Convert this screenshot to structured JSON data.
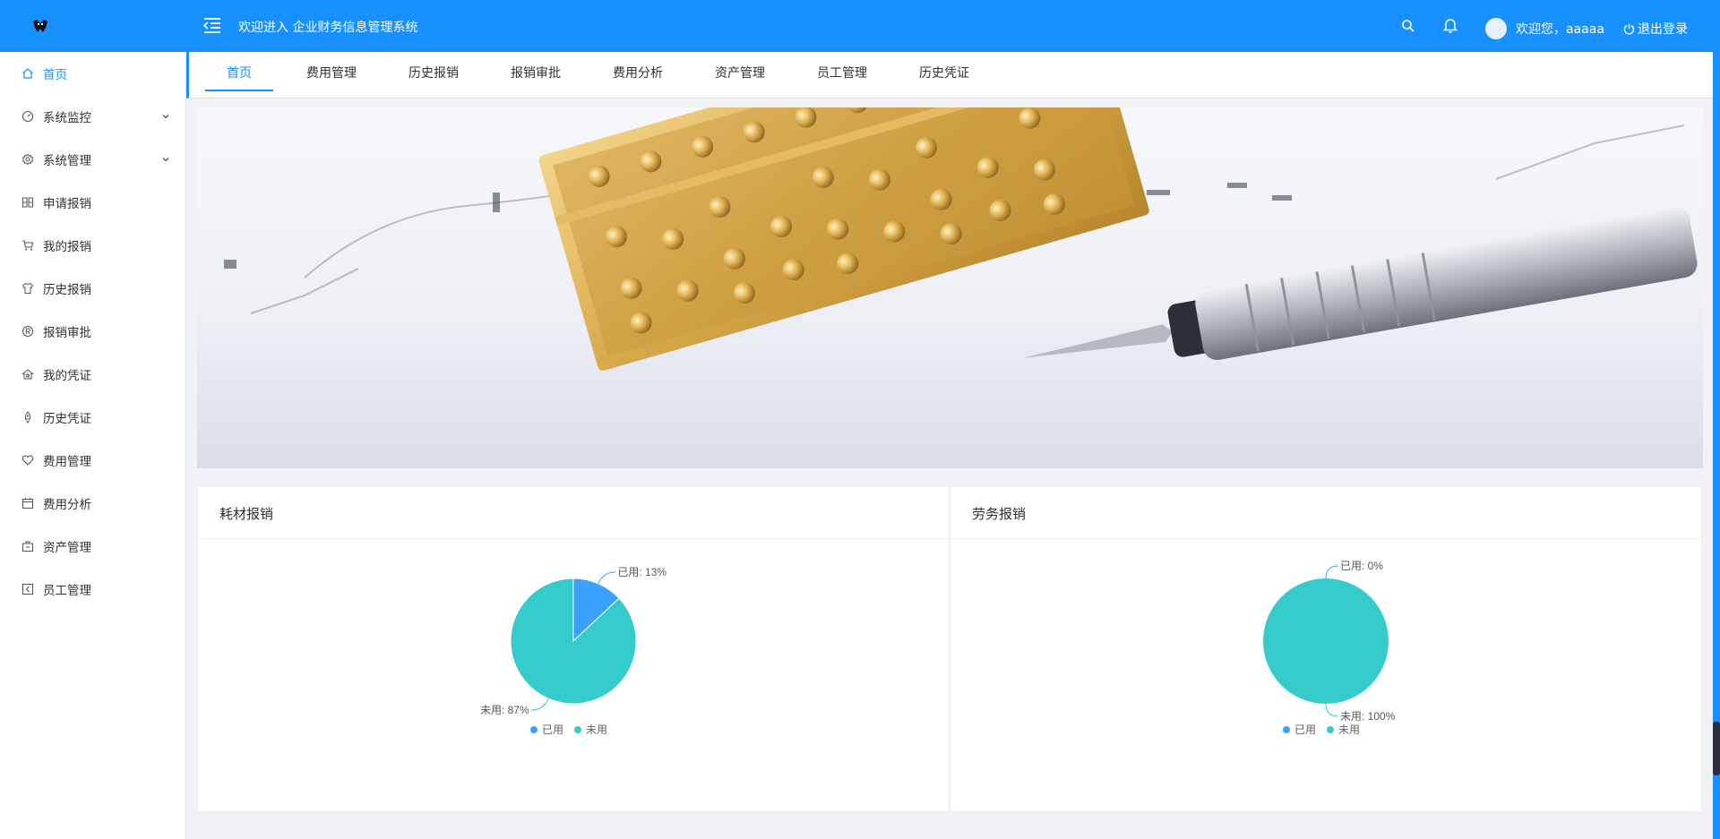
{
  "header": {
    "title": "欢迎进入 企业财务信息管理系统",
    "greeting": "欢迎您，aaaaa",
    "logout_label": "退出登录",
    "bg_color": "#1890ff"
  },
  "sidebar": {
    "items": [
      {
        "label": "首页",
        "icon": "home-icon",
        "active": true
      },
      {
        "label": "系统监控",
        "icon": "dashboard-icon",
        "expandable": true
      },
      {
        "label": "系统管理",
        "icon": "gear-icon",
        "expandable": true
      },
      {
        "label": "申请报销",
        "icon": "grid-icon"
      },
      {
        "label": "我的报销",
        "icon": "cart-icon"
      },
      {
        "label": "历史报销",
        "icon": "shirt-icon"
      },
      {
        "label": "报销审批",
        "icon": "registered-icon"
      },
      {
        "label": "我的凭证",
        "icon": "house-star-icon"
      },
      {
        "label": "历史凭证",
        "icon": "rocket-icon"
      },
      {
        "label": "费用管理",
        "icon": "heart-icon"
      },
      {
        "label": "费用分析",
        "icon": "calendar-icon"
      },
      {
        "label": "资产管理",
        "icon": "briefcase-icon"
      },
      {
        "label": "员工管理",
        "icon": "back-box-icon"
      }
    ]
  },
  "tabs": [
    {
      "label": "首页",
      "active": true
    },
    {
      "label": "费用管理"
    },
    {
      "label": "历史报销"
    },
    {
      "label": "报销审批"
    },
    {
      "label": "费用分析"
    },
    {
      "label": "资产管理"
    },
    {
      "label": "员工管理"
    },
    {
      "label": "历史凭证"
    }
  ],
  "cards": [
    {
      "title": "耗材报销"
    },
    {
      "title": "劳务报销"
    }
  ],
  "chart_data": [
    {
      "type": "pie",
      "title": "耗材报销",
      "labels": [
        "已用",
        "未用"
      ],
      "values": [
        13,
        87
      ],
      "colors": [
        "#3aa1ff",
        "#36cbcb"
      ],
      "slice_labels": [
        "已用: 13%",
        "未用: 87%"
      ],
      "legend": "bottom"
    },
    {
      "type": "pie",
      "title": "劳务报销",
      "labels": [
        "已用",
        "未用"
      ],
      "values": [
        0,
        100
      ],
      "colors": [
        "#3aa1ff",
        "#36cbcb"
      ],
      "slice_labels": [
        "已用: 0%",
        "未用: 100%"
      ],
      "legend": "bottom"
    }
  ]
}
